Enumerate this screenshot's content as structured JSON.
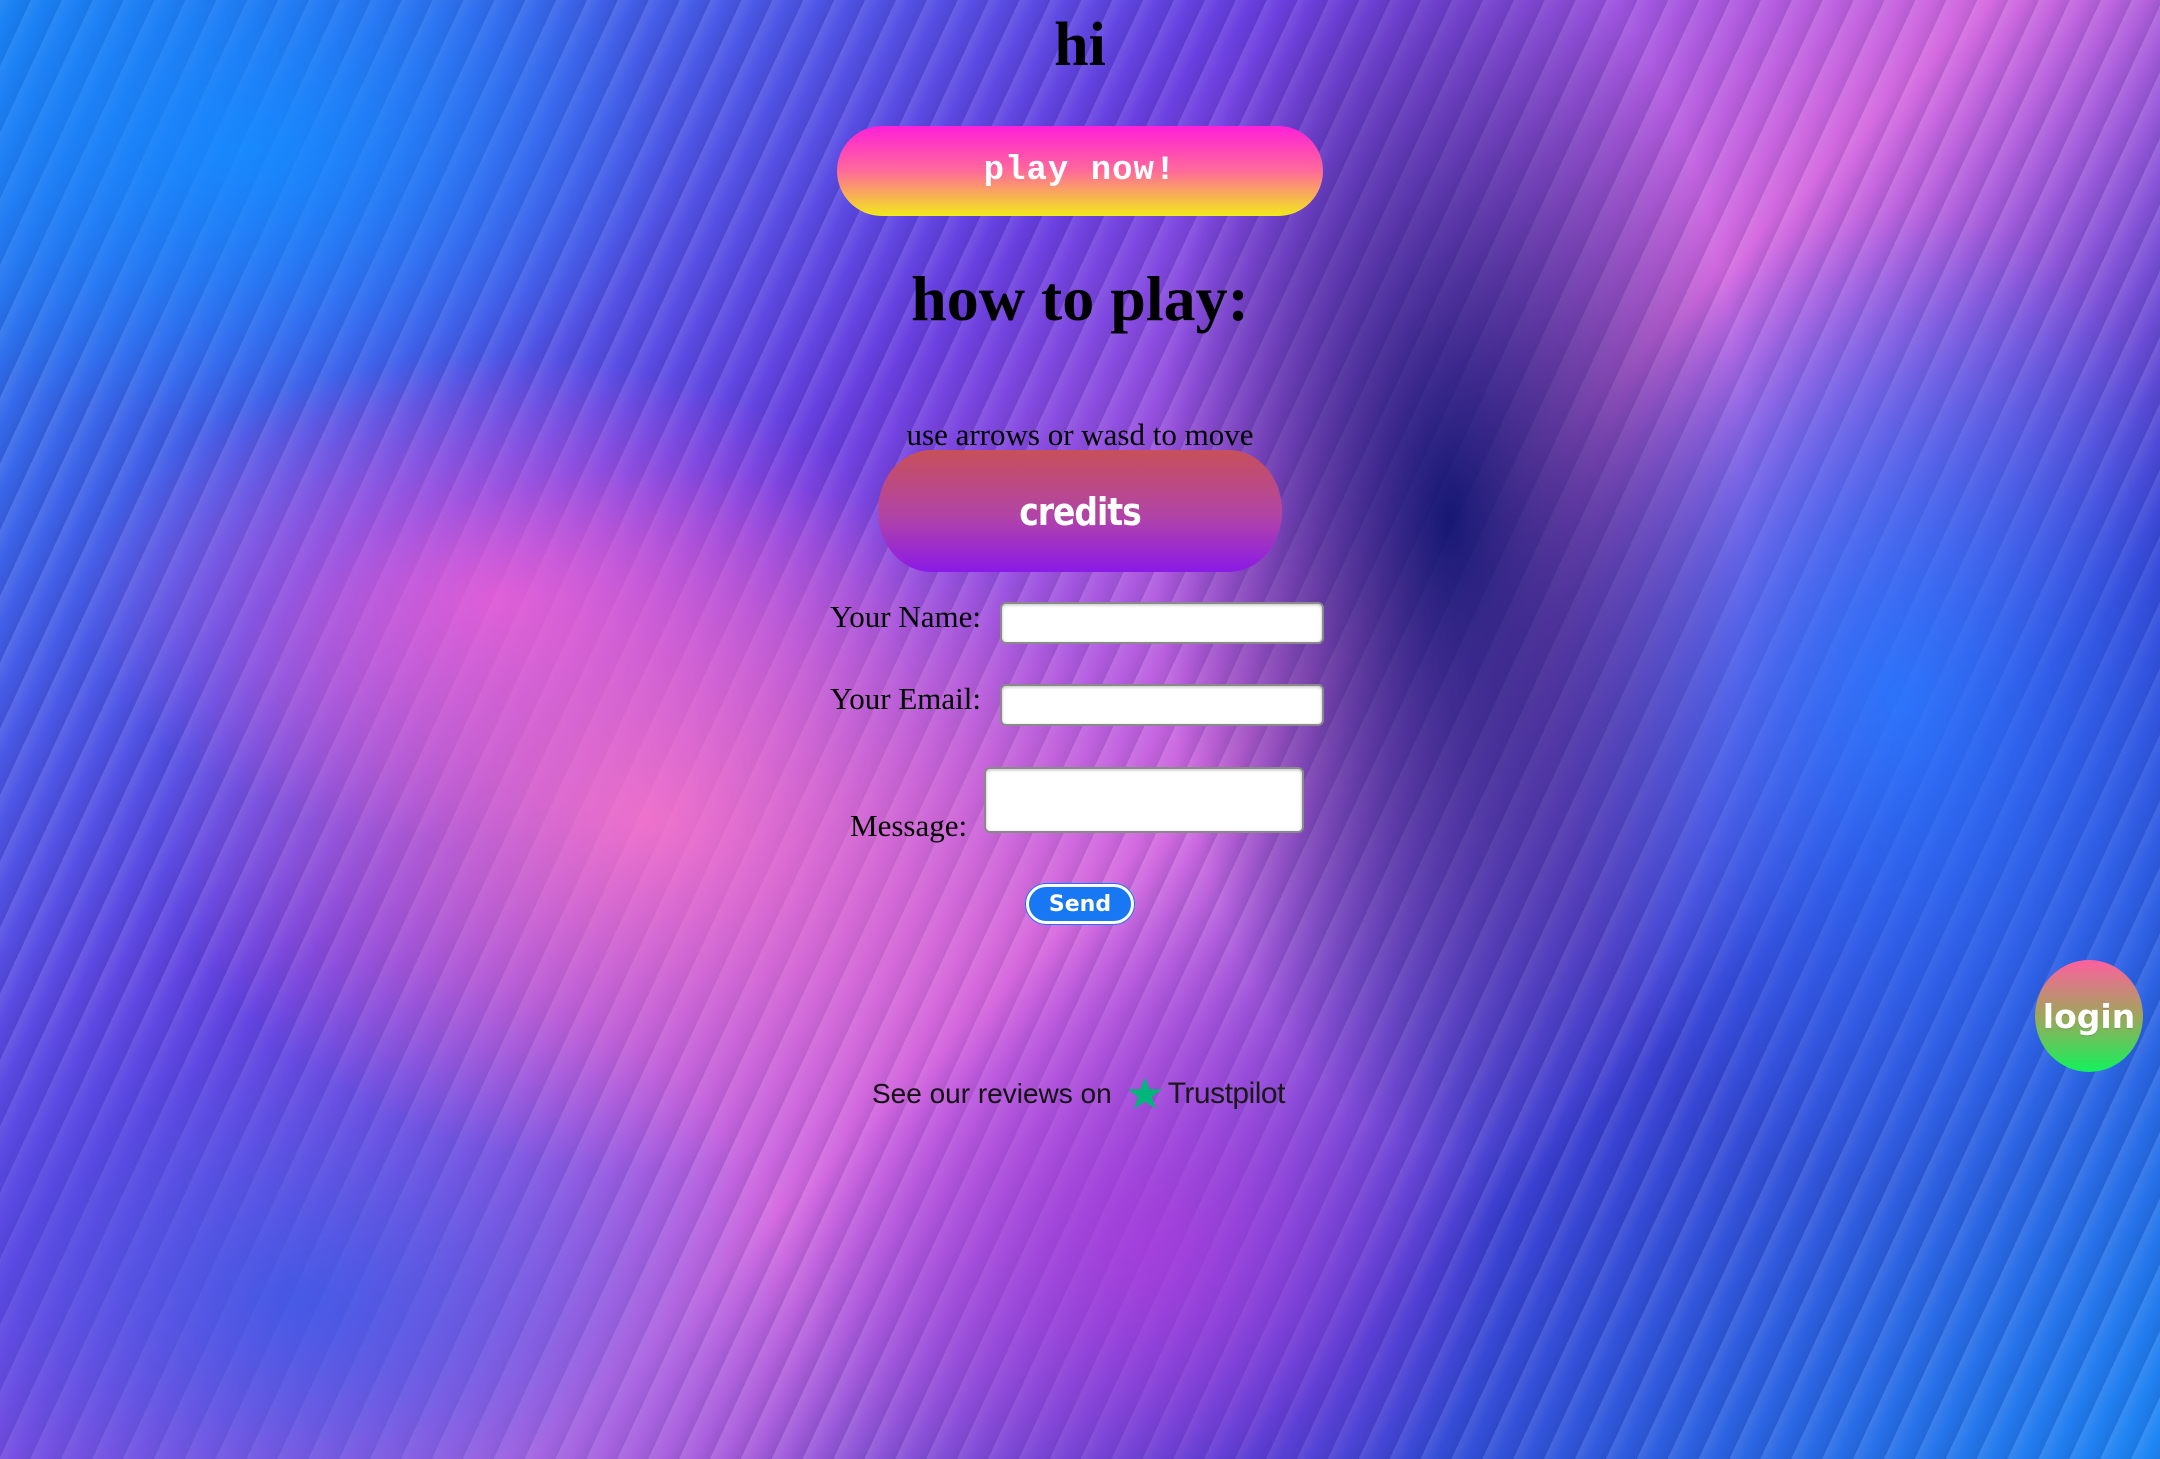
{
  "page": {
    "title": "hi",
    "play_button": "play now!",
    "how_to_heading": "how to play:",
    "instructions": "use arrows or wasd to move",
    "credits_button": "credits",
    "login_button": "login"
  },
  "contact_form": {
    "name_label": "Your Name:",
    "name_value": "",
    "email_label": "Your Email:",
    "email_value": "",
    "message_label": "Message:",
    "message_value": "",
    "send_button": "Send"
  },
  "reviews": {
    "text": "See our reviews on",
    "brand": "Trustpilot",
    "icon": "star-icon",
    "brand_color": "#00b67a"
  },
  "colors": {
    "send_button": "#1877f2"
  }
}
